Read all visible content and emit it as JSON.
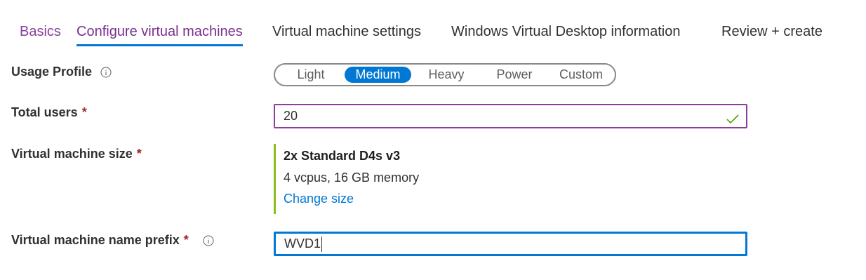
{
  "tabs": [
    {
      "label": "Basics"
    },
    {
      "label": "Configure virtual machines"
    },
    {
      "label": "Virtual machine settings"
    },
    {
      "label": "Windows Virtual Desktop information"
    },
    {
      "label": "Review + create"
    }
  ],
  "usage_profile": {
    "label": "Usage Profile",
    "options": [
      "Light",
      "Medium",
      "Heavy",
      "Power",
      "Custom"
    ],
    "selected": "Medium"
  },
  "total_users": {
    "label": "Total users",
    "required": "*",
    "value": "20"
  },
  "vm_size": {
    "label": "Virtual machine size",
    "required": "*",
    "name": "2x Standard D4s v3",
    "specs": "4 vcpus, 16 GB memory",
    "change_link": "Change size"
  },
  "name_prefix": {
    "label": "Virtual machine name prefix",
    "required": "*",
    "value": "WVD1"
  },
  "colors": {
    "accent": "#0078d4",
    "active_tab": "#7a2f8e",
    "valid": "#57a300",
    "required": "#a4262c",
    "vm_border": "#8cbd18"
  },
  "icons": [
    "info-icon",
    "check-icon"
  ]
}
